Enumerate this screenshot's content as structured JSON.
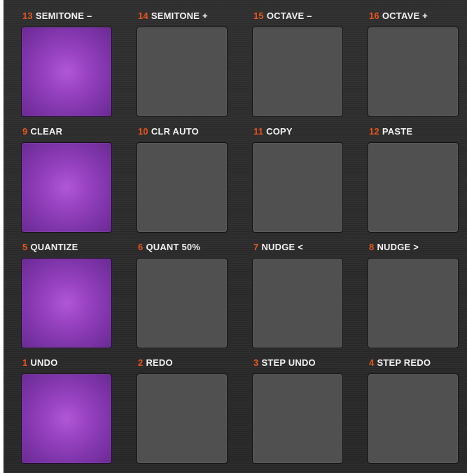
{
  "controller": {
    "accent_number_color": "#e8551c",
    "pad_lit_color": "#a94fd2",
    "pad_unlit_color": "#505050",
    "rows": [
      [
        {
          "number": "13",
          "label": "SEMITONE –",
          "lit": true
        },
        {
          "number": "14",
          "label": "SEMITONE +",
          "lit": false
        },
        {
          "number": "15",
          "label": "OCTAVE –",
          "lit": false
        },
        {
          "number": "16",
          "label": "OCTAVE +",
          "lit": false
        }
      ],
      [
        {
          "number": "9",
          "label": "CLEAR",
          "lit": true
        },
        {
          "number": "10",
          "label": "CLR AUTO",
          "lit": false
        },
        {
          "number": "11",
          "label": "COPY",
          "lit": false
        },
        {
          "number": "12",
          "label": "PASTE",
          "lit": false
        }
      ],
      [
        {
          "number": "5",
          "label": "QUANTIZE",
          "lit": true
        },
        {
          "number": "6",
          "label": "QUANT 50%",
          "lit": false
        },
        {
          "number": "7",
          "label": "NUDGE <",
          "lit": false
        },
        {
          "number": "8",
          "label": "NUDGE >",
          "lit": false
        }
      ],
      [
        {
          "number": "1",
          "label": "UNDO",
          "lit": true
        },
        {
          "number": "2",
          "label": "REDO",
          "lit": false
        },
        {
          "number": "3",
          "label": "STEP UNDO",
          "lit": false
        },
        {
          "number": "4",
          "label": "STEP REDO",
          "lit": false
        }
      ]
    ]
  }
}
